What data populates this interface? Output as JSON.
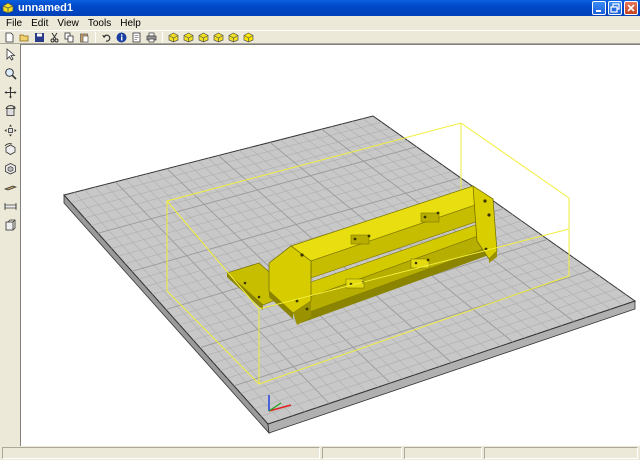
{
  "window": {
    "title": "unnamed1"
  },
  "menu": [
    "File",
    "Edit",
    "View",
    "Tools",
    "Help"
  ],
  "toolbar": {
    "icons": [
      "new-file-icon",
      "open-folder-icon",
      "save-icon",
      "cut-icon",
      "copy-icon",
      "paste-icon",
      "undo-icon",
      "info-icon",
      "document-icon",
      "print-icon",
      "view-iso-1-icon",
      "view-iso-2-icon",
      "view-iso-3-icon",
      "view-iso-4-icon",
      "view-iso-5-icon",
      "view-iso-6-icon"
    ]
  },
  "left_tools": [
    "select-arrow-icon",
    "zoom-icon",
    "pan-icon",
    "rotate-icon",
    "move-icon",
    "rotate-part-icon",
    "scale-part-icon",
    "cut-plane-icon",
    "measure-icon",
    "split-icon"
  ],
  "colors": {
    "model": "#E4D800",
    "model_dark": "#A69E00",
    "bbox": "#F2EE3A",
    "plate_top": "#C8C8C8",
    "grid": "#A8A8A8",
    "plate_side": "#9A9A9A",
    "titlebar": "#0054E3"
  }
}
